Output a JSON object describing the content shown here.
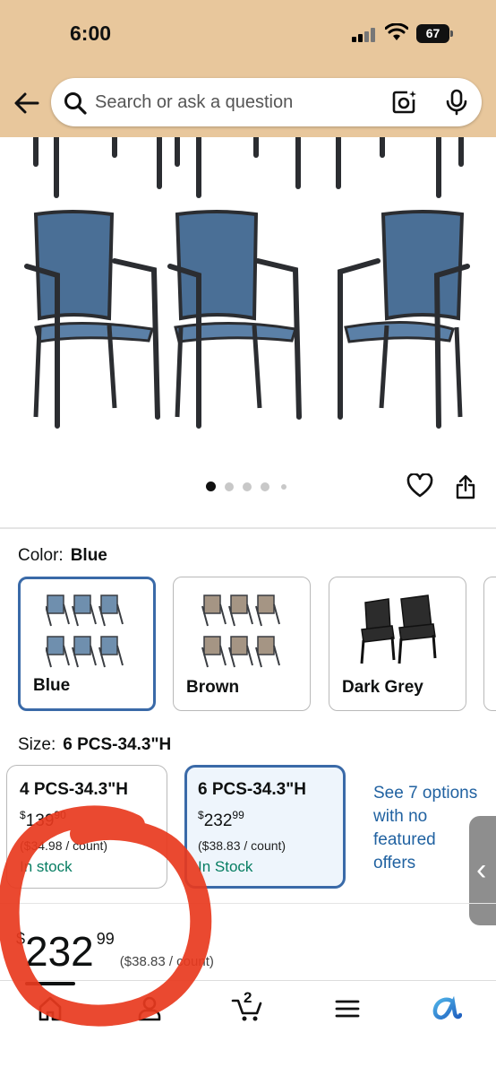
{
  "status_bar": {
    "time": "6:00",
    "battery": "67"
  },
  "search": {
    "placeholder": "Search or ask a question"
  },
  "gallery": {
    "image_count": 5,
    "active_index": 0
  },
  "color": {
    "label": "Color:",
    "selected": "Blue",
    "options": [
      {
        "label": "Blue",
        "selected": true,
        "chair_color": "#4a6f96"
      },
      {
        "label": "Brown",
        "selected": false,
        "chair_color": "#9b8a78"
      },
      {
        "label": "Dark Grey",
        "selected": false,
        "chair_color": "#2c2c2c"
      }
    ]
  },
  "size": {
    "label": "Size:",
    "selected": "6 PCS-34.3\"H",
    "options": [
      {
        "title": "4 PCS-34.3\"H",
        "currency": "$",
        "price_whole": "139",
        "price_fraction": "90",
        "unit_price": "($34.98 / count)",
        "stock": "In stock",
        "selected": false
      },
      {
        "title": "6 PCS-34.3\"H",
        "currency": "$",
        "price_whole": "232",
        "price_fraction": "99",
        "unit_price": "($38.83 / count)",
        "stock": "In Stock",
        "selected": true
      }
    ],
    "see_more": "See 7 options with no featured offers"
  },
  "price": {
    "currency": "$",
    "whole": "232",
    "fraction": "99",
    "unit_price": "($38.83 / count)"
  },
  "nav": {
    "cart_count": "2",
    "items": [
      "home-icon",
      "account-icon",
      "cart-icon",
      "menu-icon",
      "rufus-icon"
    ]
  },
  "colors": {
    "accent_blue": "#2162a1",
    "selected_border": "#3a6aa8",
    "in_stock": "#067d62",
    "header_bg": "#e8c79c",
    "annotation": "#e83a1e"
  }
}
